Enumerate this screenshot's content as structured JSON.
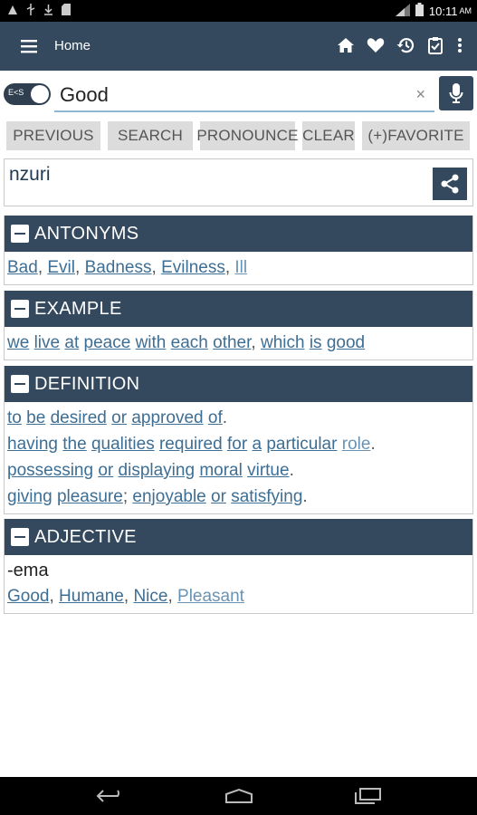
{
  "status_bar": {
    "time": "10:11",
    "ampm": "AM",
    "icons": [
      "warning-icon",
      "usb-icon",
      "download-icon",
      "sd-card-icon",
      "signal-icon",
      "battery-icon"
    ]
  },
  "app_bar": {
    "title": "Home",
    "actions": [
      "home-icon",
      "favorite-icon",
      "history-icon",
      "clipboard-icon",
      "more-icon"
    ]
  },
  "search": {
    "toggle_label": "E<S",
    "value": "Good",
    "clear_symbol": "×"
  },
  "buttons": [
    "PREVIOUS",
    "SEARCH",
    "PRONOUNCE",
    "CLEAR",
    "(+)FAVORITE"
  ],
  "result": {
    "word": "nzuri"
  },
  "sections": {
    "antonyms": {
      "title": "ANTONYMS",
      "words": [
        "Bad",
        "Evil",
        "Badness",
        "Evilness",
        "Ill"
      ]
    },
    "example": {
      "title": "EXAMPLE",
      "words": [
        "we",
        "live",
        "at",
        "peace",
        "with",
        "each",
        "other",
        "which",
        "is",
        "good"
      ]
    },
    "definition": {
      "title": "DEFINITION",
      "lines": [
        [
          "to",
          "be",
          "desired",
          "or",
          "approved",
          "of"
        ],
        [
          "having",
          "the",
          "qualities",
          "required",
          "for",
          "a",
          "particular",
          "role"
        ],
        [
          "possessing",
          "or",
          "displaying",
          "moral",
          "virtue"
        ],
        [
          "giving",
          "pleasure",
          "enjoyable",
          "or",
          "satisfying"
        ]
      ]
    },
    "adjective": {
      "title": "ADJECTIVE",
      "translation": "-ema",
      "words": [
        "Good",
        "Humane",
        "Nice",
        "Pleasant"
      ]
    }
  },
  "colors": {
    "primary": "#34495e",
    "link": "#3d6e94",
    "button_bg": "#dcdcdc"
  }
}
